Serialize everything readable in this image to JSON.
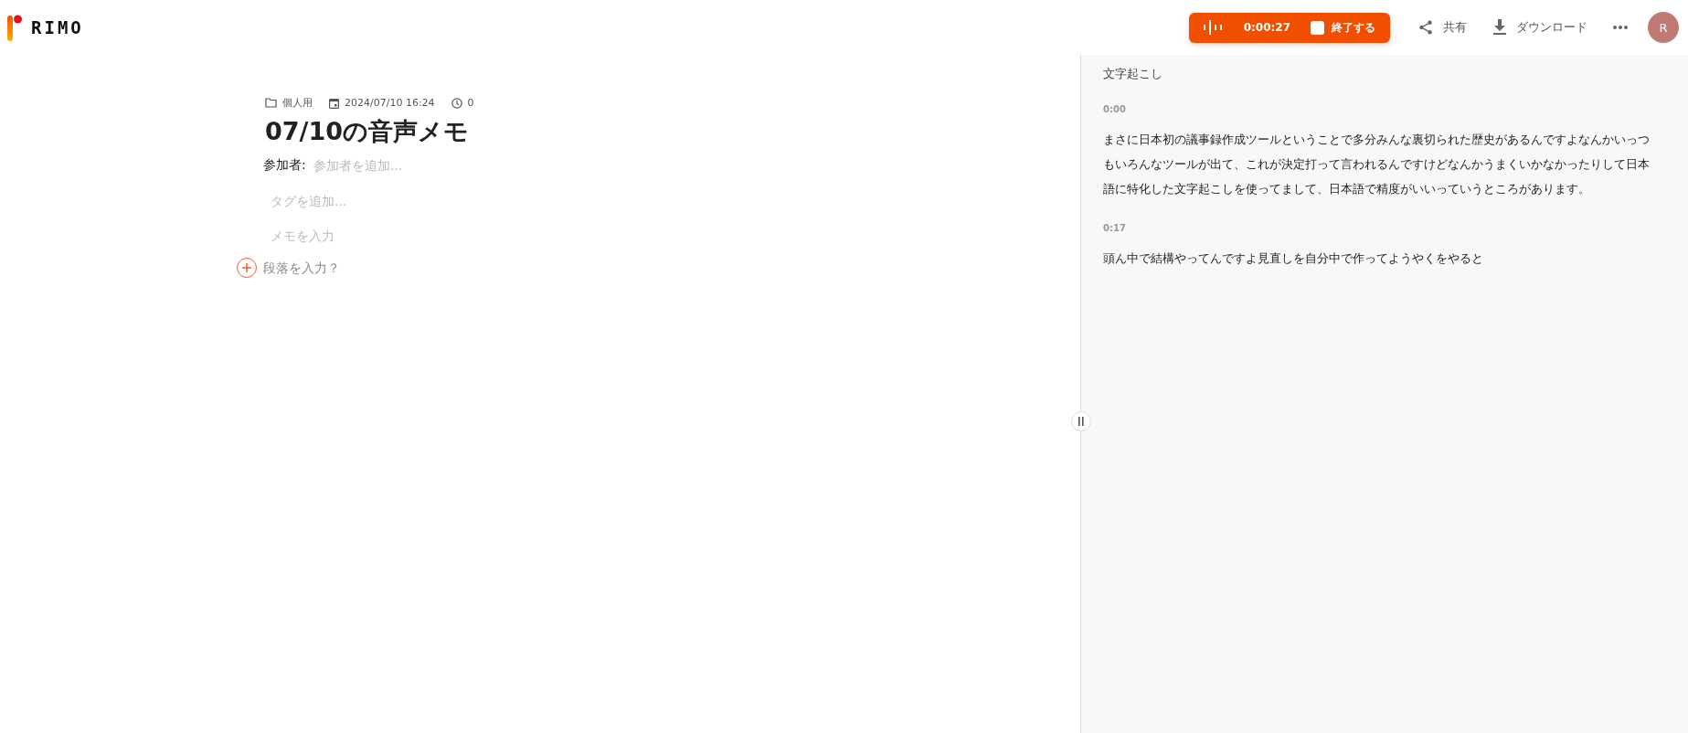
{
  "logo": {
    "text": "RIMO"
  },
  "recording": {
    "time": "0:00:27",
    "stop_label": "終了する"
  },
  "header_actions": [
    {
      "kind": "share",
      "label": "共有"
    },
    {
      "kind": "download",
      "label": "ダウンロード"
    },
    {
      "kind": "more"
    }
  ],
  "avatar": {
    "initial": "R"
  },
  "note": {
    "folder": "個人用",
    "date": "2024/07/10 16:24",
    "duration": "0",
    "title": "07/10の音声メモ",
    "participants_label": "参加者:",
    "participants_placeholder": "参加者を追加...",
    "tags_placeholder": "タグを追加...",
    "memo_placeholder": "メモを入力",
    "paragraph_placeholder": "段落を入力？"
  },
  "transcript": {
    "title": "文字起こし",
    "segments": [
      {
        "time": "0:00",
        "text": "まさに日本初の議事録作成ツールということで多分みんな裏切られた歴史があるんですよなんかいっつもいろんなツールが出て、これが決定打って言われるんですけどなんかうまくいかなかったりして日本語に特化した文字起こしを使ってまして、日本語で精度がいいっていうところがあります。"
      },
      {
        "time": "0:17",
        "text": "頭ん中で結構やってんですよ見直しを自分中で作ってようやくをやると"
      }
    ]
  }
}
